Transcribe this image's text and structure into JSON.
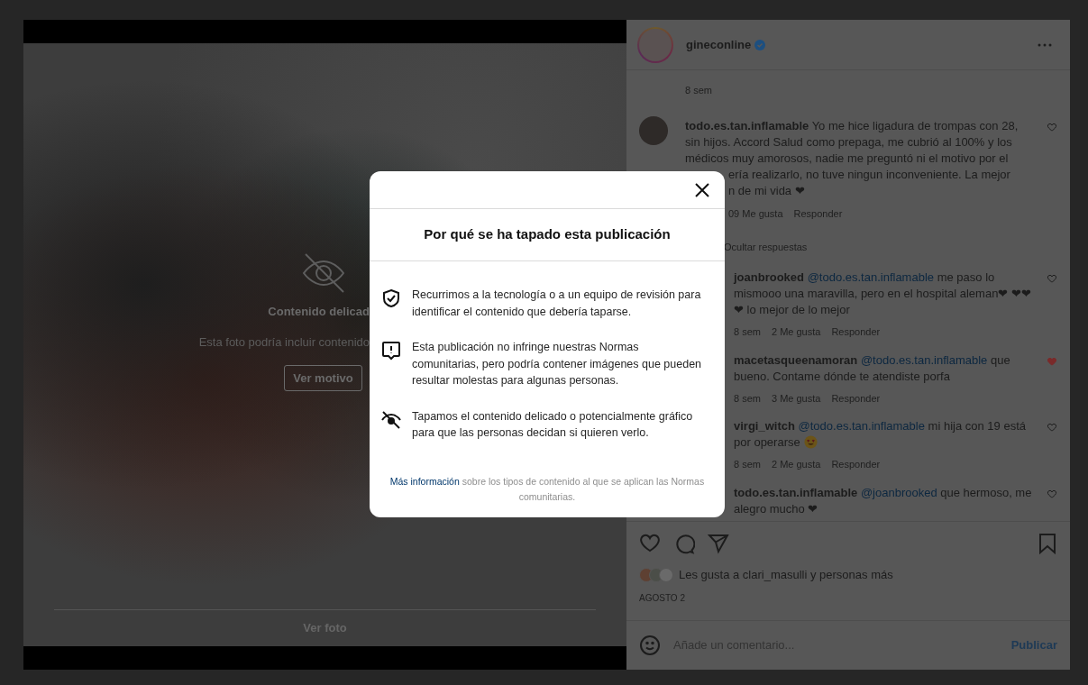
{
  "post_view": {
    "overlay_title": "Contenido delicad",
    "overlay_text": "Esta foto podría incluir contenido",
    "reason_button": "Ver motivo",
    "view_photo_button": "Ver foto"
  },
  "header": {
    "username": "gineconline",
    "verified": true
  },
  "caption_time": "8 sem",
  "first_comment": {
    "username": "todo.es.tan.inflamable",
    "text": "Yo me hice ligadura de trompas con 28, sin hijos. Accord Salud como prepaga, me cubrió al 100% y los médicos muy amorosos, nadie me preguntó ni el motivo por el",
    "continued": [
      "ería realizarlo, no tuve ningun inconveniente. La mejor",
      "n de mi vida ❤"
    ],
    "likes": "09 Me gusta",
    "reply": "Responder",
    "liked": false
  },
  "hide_replies": "Ocultar respuestas",
  "replies": [
    {
      "username": "joanbrooked",
      "mention": "@todo.es.tan.inflamable",
      "text": "me paso lo mismooo una maravilla, pero en el hospital aleman❤ ❤❤❤ lo mejor de lo mejor",
      "time": "8 sem",
      "likes": "2 Me gusta",
      "reply": "Responder",
      "liked": false,
      "kind": "plain"
    },
    {
      "username": "macetasqueenamoran",
      "mention": "@todo.es.tan.inflamable",
      "text": "que bueno. Contame dónde te atendiste porfa",
      "time": "8 sem",
      "likes": "3 Me gusta",
      "reply": "Responder",
      "liked": true,
      "kind": "plain"
    },
    {
      "username": "virgi_witch",
      "mention": "@todo.es.tan.inflamable",
      "text": "mi hija con 19 está por operarse",
      "time": "8 sem",
      "likes": "2 Me gusta",
      "reply": "Responder",
      "liked": false,
      "kind": "with-emoji"
    },
    {
      "username": "todo.es.tan.inflamable",
      "mention": "@joanbrooked",
      "text": "que hermoso, me alegro mucho ❤",
      "liked": false,
      "kind": "plain"
    }
  ],
  "likes_summary": "Les gusta a clari_masulli y personas más",
  "date": "AGOSTO 2",
  "comment_input": {
    "placeholder": "Añade un comentario...",
    "button": "Publicar",
    "disabled": true
  },
  "modal": {
    "title": "Por qué se ha tapado esta publicación",
    "items": [
      {
        "kind": "shield",
        "text": "Recurrimos a la tecnología o a un equipo de revisión para identificar el contenido que debería taparse."
      },
      {
        "kind": "alert",
        "text": "Esta publicación no infringe nuestras Normas comunitarias, pero podría contener imágenes que pueden resultar molestas para algunas personas."
      },
      {
        "kind": "eye-off",
        "text": "Tapamos el contenido delicado o potencialmente gráfico para que las personas decidan si quieren verlo."
      }
    ],
    "footer_link": "Más información",
    "footer_text": "sobre los tipos de contenido al que se aplican las Normas comunitarias."
  }
}
